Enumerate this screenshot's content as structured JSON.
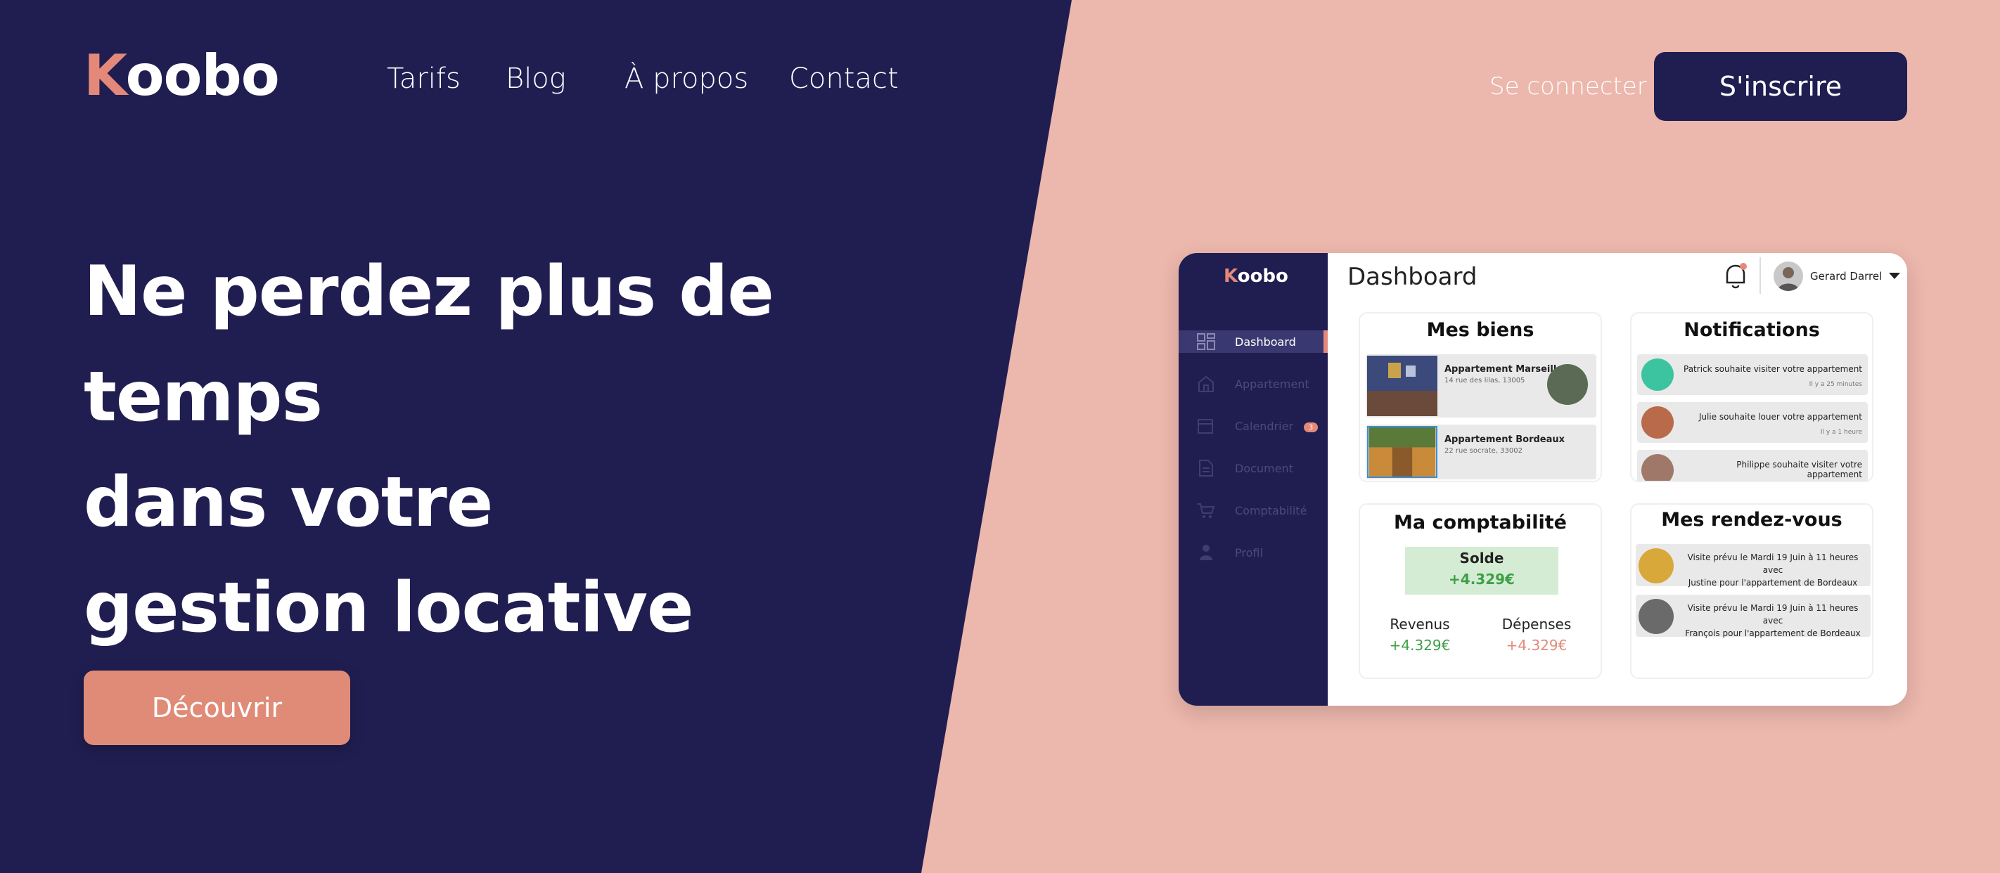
{
  "brand": {
    "first_letter": "K",
    "rest": "oobo"
  },
  "nav": {
    "items": [
      "Tarifs",
      "Blog",
      "À propos",
      "Contact"
    ]
  },
  "auth": {
    "login": "Se connecter",
    "signup": "S'inscrire"
  },
  "hero": {
    "title_lines": [
      "Ne perdez plus de temps",
      "dans votre",
      "gestion locative"
    ],
    "cta": "Découvrir"
  },
  "colors": {
    "navy": "#201e51",
    "salmon": "#ecb7ad",
    "accent": "#e08b77",
    "green": "#3da046"
  },
  "dashboard": {
    "logo_first": "K",
    "logo_rest": "oobo",
    "title": "Dashboard",
    "user": "Gerard  Darrel",
    "sidebar": [
      {
        "label": "Dashboard",
        "icon": "dashboard-icon",
        "active": true
      },
      {
        "label": "Appartement",
        "icon": "building-icon"
      },
      {
        "label": "Calendrier",
        "icon": "calendar-icon",
        "badge": "3"
      },
      {
        "label": "Document",
        "icon": "document-icon"
      },
      {
        "label": "Comptabilité",
        "icon": "cart-icon"
      },
      {
        "label": "Profil",
        "icon": "user-icon"
      }
    ],
    "biens": {
      "title": "Mes biens",
      "items": [
        {
          "name": "Appartement Marseille",
          "address": "14 rue des lilas, 13005"
        },
        {
          "name": "Appartement Bordeaux",
          "address": "22 rue socrate, 33002"
        }
      ]
    },
    "notifications": {
      "title": "Notifications",
      "items": [
        {
          "text": "Patrick souhaite visiter votre appartement",
          "time": "Il y a 25 minutes"
        },
        {
          "text": "Julie souhaite louer votre appartement",
          "time": "Il y a 1 heure"
        },
        {
          "text": "Philippe souhaite visiter votre appartement",
          "time": ""
        }
      ]
    },
    "comptabilite": {
      "title": "Ma comptabilité",
      "solde_label": "Solde",
      "solde_value": "+4.329€",
      "revenus_label": "Revenus",
      "revenus_value": "+4.329€",
      "depenses_label": "Dépenses",
      "depenses_value": "+4.329€"
    },
    "rdv": {
      "title": "Mes rendez-vous",
      "items": [
        {
          "line1": "Visite prévu le Mardi 19 Juin à 11 heures avec",
          "line2": "Justine pour l'appartement de Bordeaux"
        },
        {
          "line1": "Visite prévu le Mardi 19 Juin à 11 heures avec",
          "line2": "François pour l'appartement de Bordeaux"
        }
      ]
    }
  }
}
